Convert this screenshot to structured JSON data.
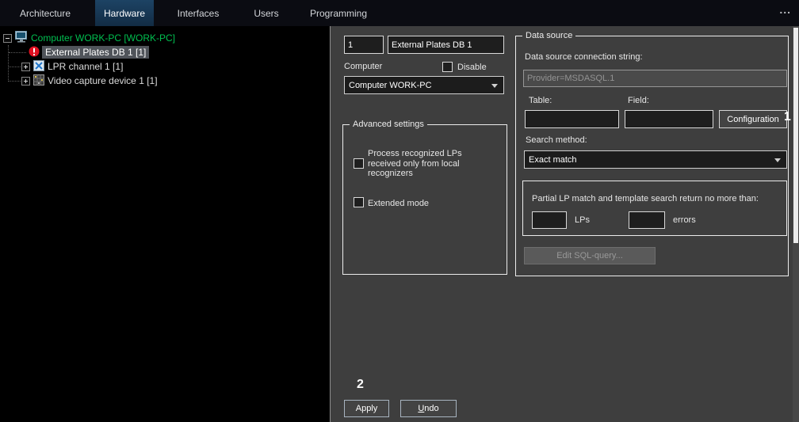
{
  "topbar": {
    "overflow_label": "...",
    "tabs": [
      {
        "label": "Architecture"
      },
      {
        "label": "Hardware"
      },
      {
        "label": "Interfaces"
      },
      {
        "label": "Users"
      },
      {
        "label": "Programming"
      }
    ]
  },
  "tree": {
    "items": [
      {
        "label": "Computer WORK-PC [WORK-PC]"
      },
      {
        "label": "External Plates DB 1 [1]"
      },
      {
        "label": "LPR channel  1 [1]"
      },
      {
        "label": "Video capture device 1 [1]"
      }
    ]
  },
  "editor": {
    "id_value": "1",
    "name_value": "External Plates DB 1",
    "computer_label": "Computer",
    "disable_label": "Disable",
    "computer_select_value": "Computer WORK-PC",
    "advanced_title": "Advanced settings",
    "process_checkbox_label": "Process recognized LPs received only from local recognizers",
    "extended_checkbox_label": "Extended mode",
    "apply_label": "Apply",
    "undo_label": "Undo"
  },
  "data_source": {
    "title": "Data source",
    "connection_label": "Data source connection string:",
    "connection_value": "Provider=MSDASQL.1",
    "table_label": "Table:",
    "field_label": "Field:",
    "table_value": "",
    "field_value": "",
    "configuration_label": "Configuration",
    "search_method_label": "Search method:",
    "search_method_value": "Exact match",
    "partial_match_text": "Partial LP match and template search return no more than:",
    "lps_value": "",
    "lps_label": "LPs",
    "errors_value": "",
    "errors_label": "errors",
    "edit_sql_label": "Edit SQL-query..."
  },
  "annotations": {
    "callout_1": "1",
    "callout_2": "2"
  },
  "colors": {
    "panel_bg": "#3e3e3e",
    "tree_bg": "#000000",
    "topbar_bg": "#0b0c12",
    "active_tab_bg": "#1d4364",
    "computer_node_green": "#00c050",
    "selection_bg": "#50545a",
    "error_red": "#e01020"
  }
}
